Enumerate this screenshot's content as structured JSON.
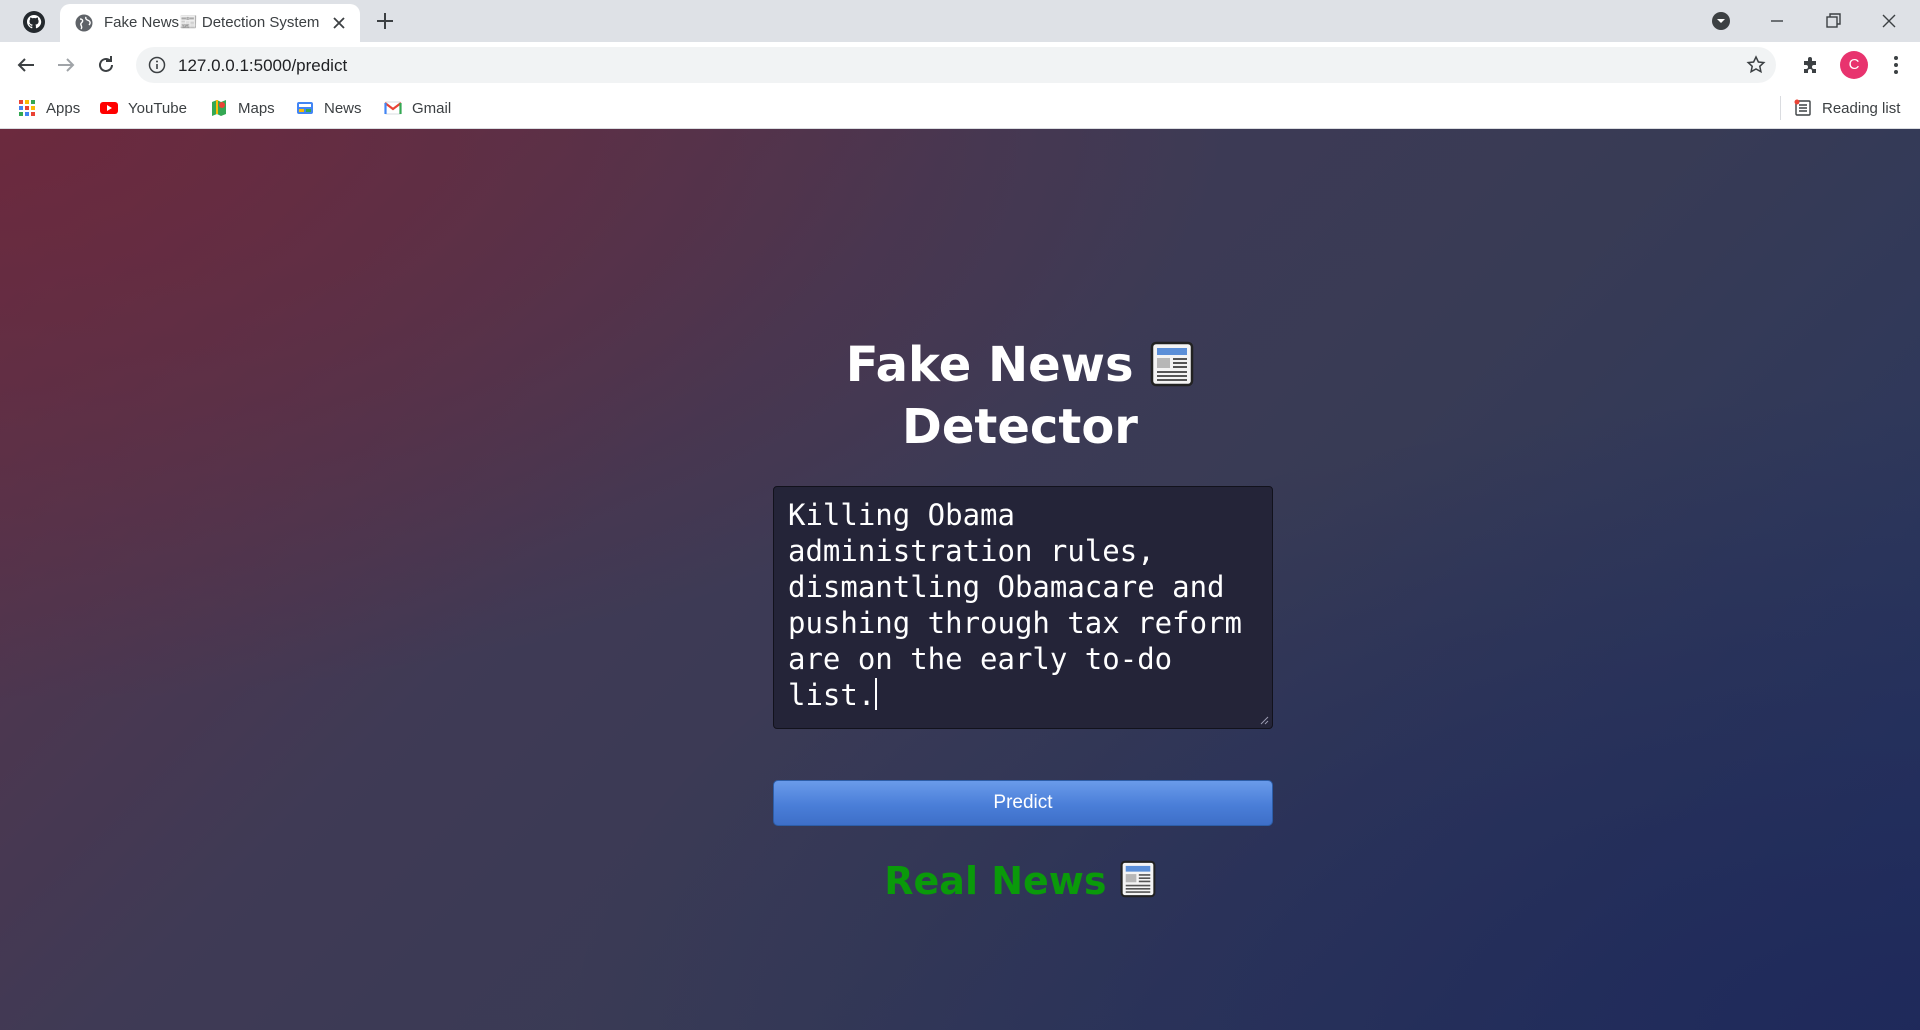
{
  "browser": {
    "tab_title": "Fake News📰 Detection System",
    "url": "127.0.0.1:5000/predict",
    "profile_initial": "C",
    "bookmarks": [
      {
        "label": "Apps",
        "icon": "apps-grid-icon"
      },
      {
        "label": "YouTube",
        "icon": "youtube-icon"
      },
      {
        "label": "Maps",
        "icon": "maps-icon"
      },
      {
        "label": "News",
        "icon": "news-icon"
      },
      {
        "label": "Gmail",
        "icon": "gmail-icon"
      }
    ],
    "reading_list_label": "Reading list"
  },
  "page": {
    "heading_line1": "Fake News",
    "heading_line2": "Detector",
    "heading_icon": "newspaper-emoji",
    "textarea_value": "Killing Obama administration rules, dismantling Obamacare and pushing through tax reform are on the early to-do list.",
    "predict_label": "Predict",
    "result_text": "Real News",
    "result_color": "#0a9a0a"
  }
}
